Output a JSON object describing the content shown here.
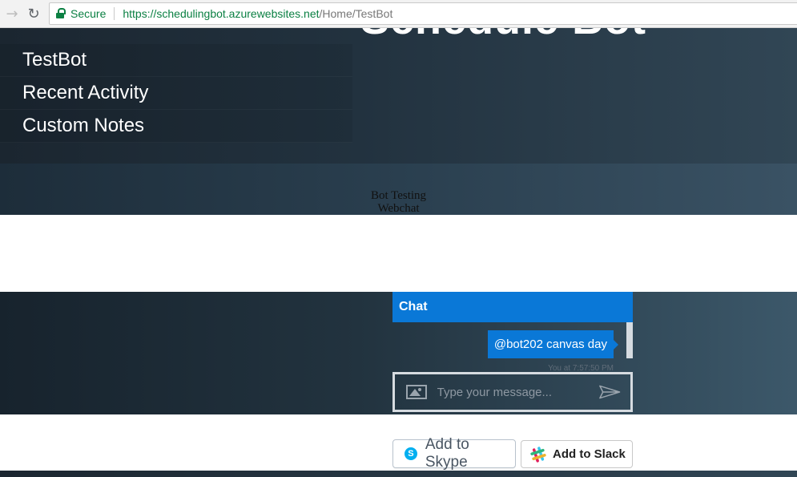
{
  "browser": {
    "secure_label": "Secure",
    "url_host": "https://schedulingbot.azurewebsites.net",
    "url_path": "/Home/TestBot",
    "back_icon": "arrow-back-icon",
    "reload_icon": "reload-icon"
  },
  "header": {
    "title": "Schedule Bot",
    "menu": [
      {
        "label": "TestBot"
      },
      {
        "label": "Recent Activity"
      },
      {
        "label": "Custom Notes"
      }
    ]
  },
  "caption": {
    "line1": "Bot Testing",
    "line2": "Webchat"
  },
  "chat": {
    "header": "Chat",
    "message": "@bot202 canvas day",
    "timestamp": "You at 7:57:50 PM",
    "placeholder": "Type your message...",
    "accent_color": "#0a78d7"
  },
  "buttons": {
    "skype": "Add to Skype",
    "slack_prefix": "Add to ",
    "slack_brand": "Slack"
  }
}
